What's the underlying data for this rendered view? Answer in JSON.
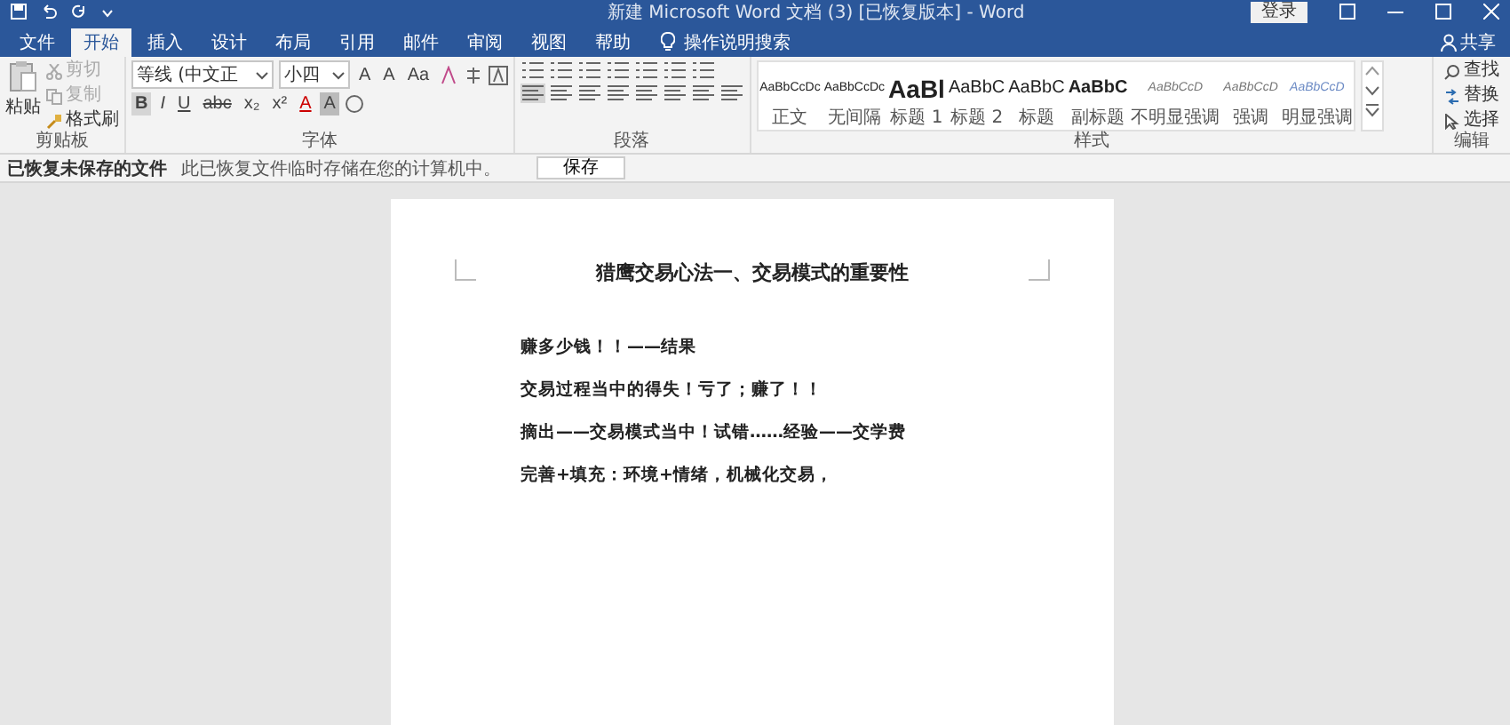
{
  "title_bar": {
    "title": "新建 Microsoft Word 文档 (3) [已恢复版本] - Word",
    "login": "登录"
  },
  "tabs": [
    {
      "label": "文件",
      "selected": false
    },
    {
      "label": "开始",
      "selected": true
    },
    {
      "label": "插入",
      "selected": false
    },
    {
      "label": "设计",
      "selected": false
    },
    {
      "label": "布局",
      "selected": false
    },
    {
      "label": "引用",
      "selected": false
    },
    {
      "label": "邮件",
      "selected": false
    },
    {
      "label": "审阅",
      "selected": false
    },
    {
      "label": "视图",
      "selected": false
    },
    {
      "label": "帮助",
      "selected": false
    }
  ],
  "tell_me": "操作说明搜索",
  "share": "共享",
  "clipboard": {
    "paste": "粘贴",
    "cut": "剪切",
    "copy": "复制",
    "format_painter": "格式刷",
    "label": "剪贴板"
  },
  "font": {
    "name": "等线 (中文正",
    "size": "小四",
    "row1": [
      "A",
      "A",
      "Aa"
    ],
    "row2": [
      "B",
      "I",
      "U",
      "abc",
      "x₂",
      "x²",
      "A",
      "A"
    ],
    "label": "字体"
  },
  "paragraph": {
    "label": "段落"
  },
  "styles": {
    "items": [
      {
        "sample": "AaBbCcDc",
        "label": "正文",
        "kind": "normal"
      },
      {
        "sample": "AaBbCcDc",
        "label": "无间隔",
        "kind": "normal"
      },
      {
        "sample": "AaBl",
        "label": "标题 1",
        "kind": "heading1"
      },
      {
        "sample": "AaBbC",
        "label": "标题 2",
        "kind": "heading2"
      },
      {
        "sample": "AaBbC",
        "label": "标题",
        "kind": "heading2"
      },
      {
        "sample": "AaBbC",
        "label": "副标题",
        "kind": "subtitle"
      },
      {
        "sample": "AaBbCcD",
        "label": "不明显强调",
        "kind": "emphasis"
      },
      {
        "sample": "AaBbCcD",
        "label": "强调",
        "kind": "emphasis"
      },
      {
        "sample": "AaBbCcD",
        "label": "明显强调",
        "kind": "intense"
      }
    ],
    "label": "样式"
  },
  "editing": {
    "find": "查找",
    "replace": "替换",
    "select": "选择",
    "label": "编辑"
  },
  "info_bar": {
    "title": "已恢复未保存的文件",
    "message": "此已恢复文件临时存储在您的计算机中。",
    "button": "保存"
  },
  "document": {
    "title": "猎鹰交易心法一、交易模式的重要性",
    "paragraphs": [
      "赚多少钱！！——结果",
      "交易过程当中的得失！亏了；赚了！！",
      "摘出——交易模式当中！试错……经验——交学费",
      "完善+填充：环境+情绪，机械化交易，"
    ]
  }
}
